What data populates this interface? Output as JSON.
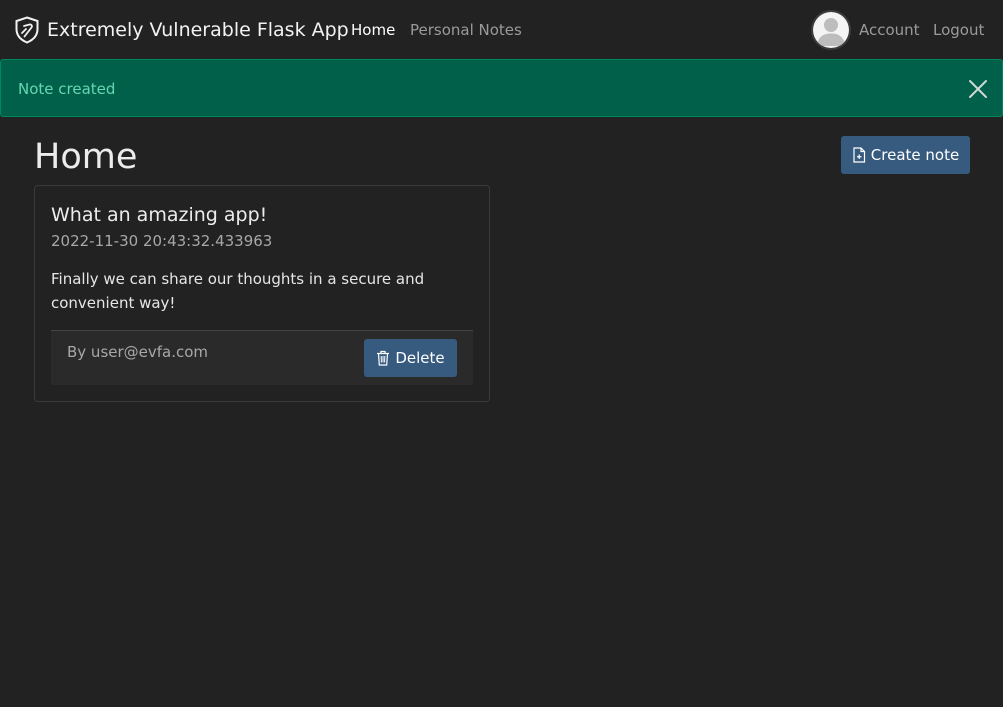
{
  "navbar": {
    "brand": "Extremely Vulnerable Flask App",
    "brand_icon": "shield-icon",
    "links": {
      "home": "Home",
      "personal_notes": "Personal Notes",
      "account": "Account",
      "logout": "Logout"
    },
    "avatar_icon": "user-avatar-icon"
  },
  "alert": {
    "message": "Note created",
    "close_icon": "close-icon"
  },
  "main": {
    "title": "Home",
    "create_button_label": "Create note",
    "create_button_icon": "file-plus-icon"
  },
  "notes": [
    {
      "title": "What an amazing app!",
      "timestamp": "2022-11-30 20:43:32.433963",
      "body": "Finally we can share our thoughts in a secure and convenient way!",
      "author": "By user@evfa.com",
      "delete_label": "Delete",
      "delete_icon": "trash-icon"
    }
  ],
  "colors": {
    "background": "#222222",
    "primary": "#375a7f",
    "alert_bg": "#00604a",
    "alert_text": "#66d6b0"
  }
}
